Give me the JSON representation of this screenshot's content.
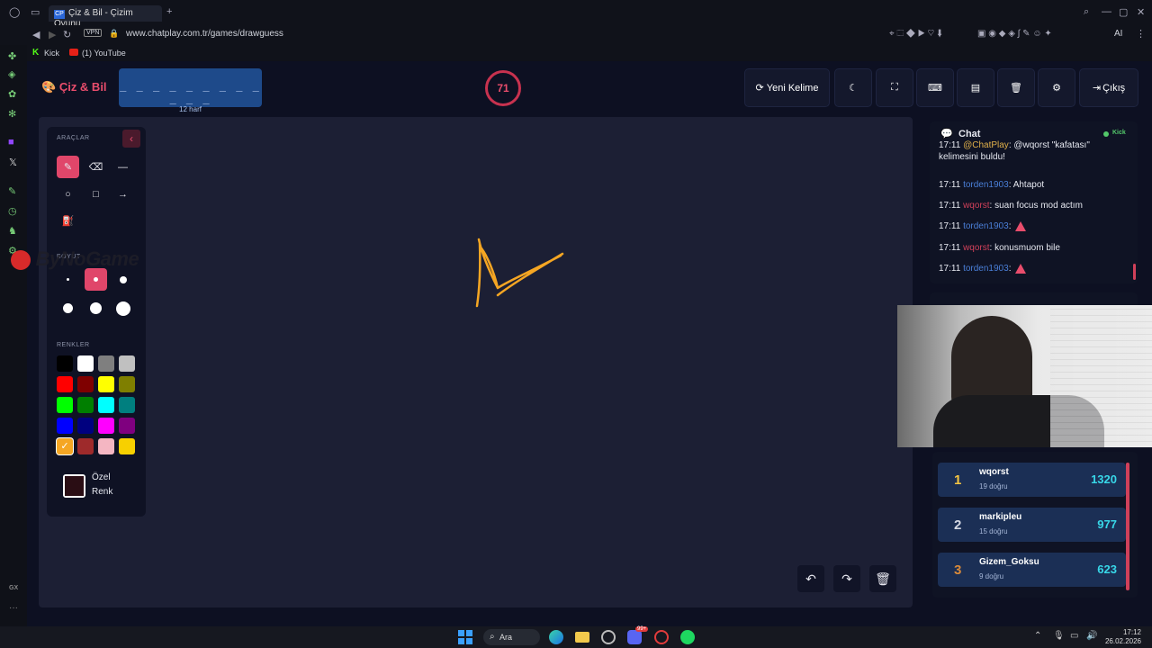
{
  "browser": {
    "tab_title": "Çiz & Bil - Çizim Oyunu",
    "tab_icon_text": "CP",
    "vpn_label": "VPN",
    "url": "www.chatplay.com.tr/games/drawguess",
    "bookmarks": [
      "Kick",
      "(1) YouTube"
    ],
    "ai_label": "AI"
  },
  "app": {
    "logo": "Çiz & Bil",
    "word_dashes": "_ _ _ _ _ _ _ _ _ _ _ _",
    "word_length": "12 harf",
    "timer": "71",
    "toolbar": {
      "new_word": "Yeni Kelime",
      "exit": "Çıkış"
    }
  },
  "tools": {
    "title": "ARAÇLAR",
    "size_title": "BOYUT",
    "colors_title": "RENKLER",
    "custom_color_line1": "Özel",
    "custom_color_line2": "Renk",
    "swatches": [
      "#000000",
      "#ffffff",
      "#7f7f7f",
      "#c0c0c0",
      "#ff0000",
      "#7f0000",
      "#ffff00",
      "#7f7f00",
      "#00ff00",
      "#007f00",
      "#00ffff",
      "#007f7f",
      "#0000ff",
      "#00007f",
      "#ff00ff",
      "#7f007f",
      "#f5a623",
      "#9e2a2b",
      "#f4b6c2",
      "#f7d000"
    ],
    "selected_swatch_index": 16,
    "custom_color": "#2a0d14"
  },
  "watermark": "ByNoGame",
  "chat": {
    "title": "Chat",
    "platform": "Kick",
    "messages": [
      {
        "time": "17:11",
        "user": "@ChatPlay",
        "text": ": @wqorst \"kafatası\" kelimesini buldu!",
        "color": "gold"
      },
      {
        "time": "17:11",
        "user": "torden1903",
        "text": ": Ahtapot",
        "color": "blue"
      },
      {
        "time": "17:11",
        "user": "wqorst",
        "text": ": suan focus mod actım",
        "color": "red"
      },
      {
        "time": "17:11",
        "user": "torden1903",
        "text": ":",
        "color": "blue",
        "emote": true
      },
      {
        "time": "17:11",
        "user": "wqorst",
        "text": ": konusmuom bile",
        "color": "red"
      },
      {
        "time": "17:11",
        "user": "torden1903",
        "text": ":",
        "color": "blue",
        "emote": true
      }
    ]
  },
  "leaderboard": [
    {
      "rank": "1",
      "name": "wqorst",
      "sub": "19 doğru",
      "score": "1320",
      "rank_color": "#f5c542"
    },
    {
      "rank": "2",
      "name": "markipleu",
      "sub": "15 doğru",
      "score": "977",
      "rank_color": "#d5d9e4"
    },
    {
      "rank": "3",
      "name": "Gizem_Goksu",
      "sub": "9 doğru",
      "score": "623",
      "rank_color": "#d98a3a"
    }
  ],
  "stream_overlay": {
    "user": "torden1903",
    "suffix": ":"
  },
  "taskbar": {
    "search_label": "Ara",
    "time": "17:12",
    "date": "26.02.2026",
    "discord_badge": "99+"
  },
  "left_rail_label": "GX"
}
